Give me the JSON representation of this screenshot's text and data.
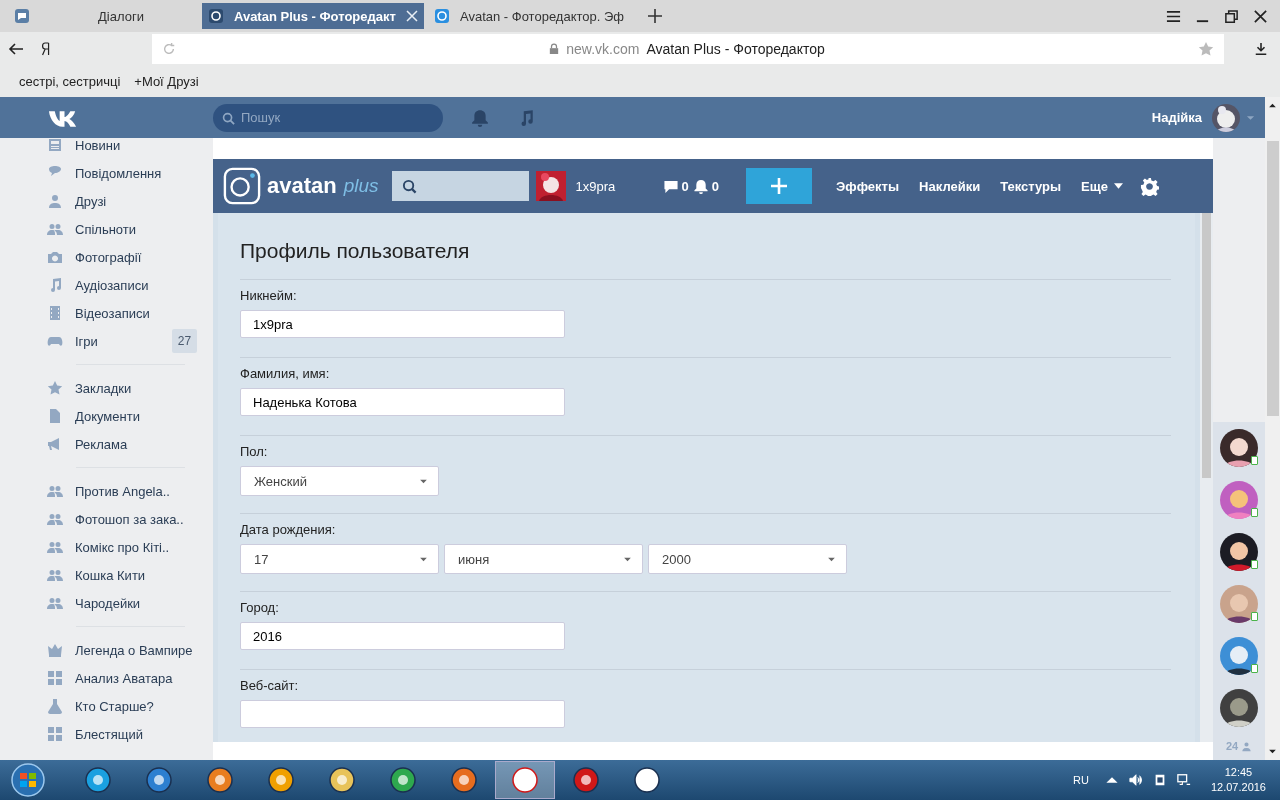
{
  "browser": {
    "tabs": [
      {
        "label": "Діалоги",
        "selected": false
      },
      {
        "label": "Avatan Plus - Фоторедакт",
        "selected": true
      },
      {
        "label": "Avatan - Фоторедактор. Эф",
        "selected": false
      }
    ],
    "address": {
      "domain": "new.vk.com",
      "title": "Avatan Plus - Фоторедактор"
    },
    "bookmarks": [
      "сестрі, сестричці",
      "+Мої Друзі"
    ]
  },
  "vk_header": {
    "search": {
      "placeholder": "Пошук"
    },
    "user": "Надійка"
  },
  "sidebar": {
    "sections": [
      {
        "items": [
          {
            "label": "Новини"
          },
          {
            "label": "Повідомлення"
          },
          {
            "label": "Друзі"
          },
          {
            "label": "Спільноти"
          },
          {
            "label": "Фотографії"
          },
          {
            "label": "Аудіозаписи"
          },
          {
            "label": "Відеозаписи"
          },
          {
            "label": "Ігри",
            "badge": "27"
          }
        ]
      },
      {
        "items": [
          {
            "label": "Закладки"
          },
          {
            "label": "Документи"
          },
          {
            "label": "Реклама"
          }
        ]
      },
      {
        "items": [
          {
            "label": "Против Angela.."
          },
          {
            "label": "Фотошоп за зака.."
          },
          {
            "label": "Комікс про Кіті.."
          },
          {
            "label": "Кошка Кити"
          },
          {
            "label": "Чародейки"
          }
        ]
      },
      {
        "items": [
          {
            "label": "Легенда о Вампире"
          },
          {
            "label": "Анализ Аватара"
          },
          {
            "label": "Кто Старше?"
          },
          {
            "label": "Блестящий"
          }
        ]
      }
    ]
  },
  "app_bar": {
    "logo": "avatan",
    "logo_suffix": "plus",
    "username": "1x9pra",
    "messages": "0",
    "notifications": "0",
    "nav": [
      "Эффекты",
      "Наклейки",
      "Текстуры",
      "Еще"
    ]
  },
  "profile": {
    "title": "Профиль пользователя",
    "fields": [
      {
        "kind": "text",
        "label": "Никнейм:",
        "value": "1x9pra"
      },
      {
        "kind": "text",
        "label": "Фамилия, имя:",
        "value": "Наденька Котова"
      },
      {
        "kind": "select",
        "label": "Пол:",
        "values": [
          "Женский"
        ]
      },
      {
        "kind": "select",
        "label": "Дата рождения:",
        "values": [
          "17",
          "июня",
          "2000"
        ]
      },
      {
        "kind": "text",
        "label": "Город:",
        "value": "2016"
      },
      {
        "kind": "text",
        "label": "Веб-сайт:"
      }
    ]
  },
  "friends": {
    "items": [
      {
        "online": true
      },
      {
        "online": true
      },
      {
        "online": true
      },
      {
        "online": true
      },
      {
        "online": true
      },
      {
        "online": false
      }
    ],
    "count": "24"
  },
  "taskbar": {
    "language": "RU",
    "time": "12:45",
    "date": "12.07.2016"
  }
}
